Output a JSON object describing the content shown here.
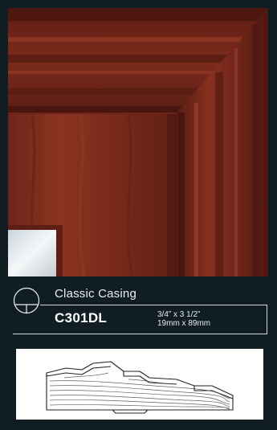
{
  "product": {
    "name": "Classic Casing",
    "code": "C301DL",
    "size_imperial": "3/4” x 3 1/2”",
    "size_metric": "19mm x 89mm"
  },
  "icons": {
    "logo": "circle-t-logo-icon",
    "profile": "casing-profile-drawing"
  },
  "colors": {
    "background": "#101e24",
    "wood": "#7a2a1c",
    "text": "#e9eef0"
  }
}
